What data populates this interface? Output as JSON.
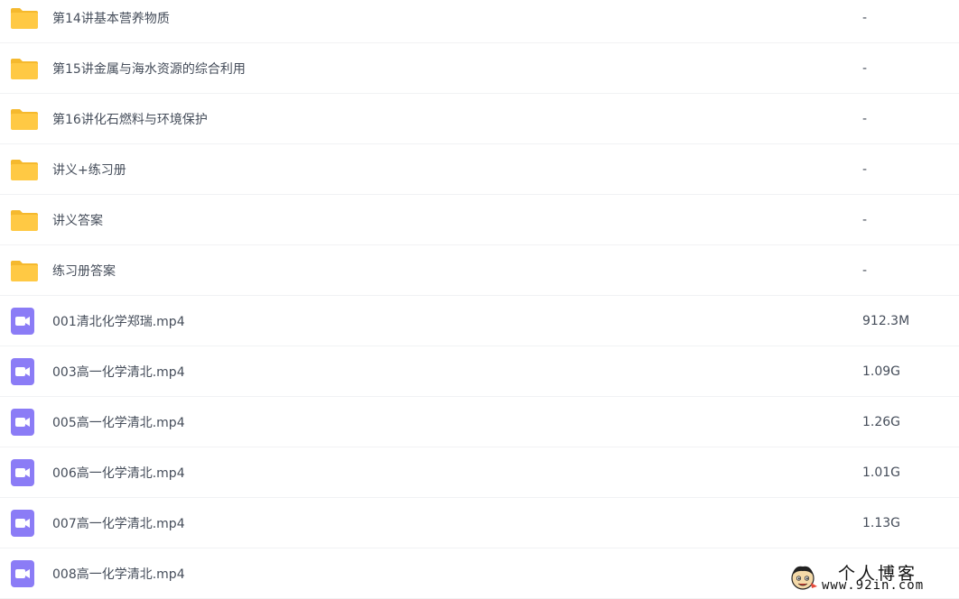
{
  "files": [
    {
      "type": "folder",
      "icon": "folder-icon",
      "name": "第14讲基本营养物质",
      "size": "-"
    },
    {
      "type": "folder",
      "icon": "folder-icon",
      "name": "第15讲金属与海水资源的综合利用",
      "size": "-"
    },
    {
      "type": "folder",
      "icon": "folder-icon",
      "name": "第16讲化石燃料与环境保护",
      "size": "-"
    },
    {
      "type": "folder",
      "icon": "folder-icon",
      "name": "讲义+练习册",
      "size": "-"
    },
    {
      "type": "folder",
      "icon": "folder-icon",
      "name": "讲义答案",
      "size": "-"
    },
    {
      "type": "folder",
      "icon": "folder-icon",
      "name": "练习册答案",
      "size": "-"
    },
    {
      "type": "video",
      "icon": "video-file-icon",
      "name": "001清北化学郑瑞.mp4",
      "size": "912.3M"
    },
    {
      "type": "video",
      "icon": "video-file-icon",
      "name": "003高一化学清北.mp4",
      "size": "1.09G"
    },
    {
      "type": "video",
      "icon": "video-file-icon",
      "name": "005高一化学清北.mp4",
      "size": "1.26G"
    },
    {
      "type": "video",
      "icon": "video-file-icon",
      "name": "006高一化学清北.mp4",
      "size": "1.01G"
    },
    {
      "type": "video",
      "icon": "video-file-icon",
      "name": "007高一化学清北.mp4",
      "size": "1.13G"
    },
    {
      "type": "video",
      "icon": "video-file-icon",
      "name": "008高一化学清北.mp4",
      "size": ""
    }
  ],
  "colors": {
    "folder": "#ffc944",
    "folder_tab": "#f5b92e",
    "video": "#8b7cf6",
    "text": "#454d5a",
    "divider": "#f1f2f4"
  },
  "watermark": {
    "title": "个人博客",
    "url": "www.92in.com",
    "icon": "cartoon-mascot-icon"
  }
}
